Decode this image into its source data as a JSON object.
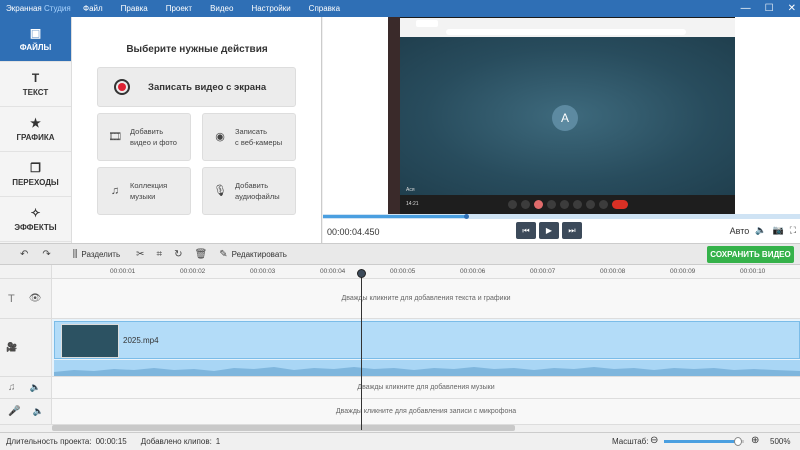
{
  "window": {
    "app_name": "Экранная",
    "app_name_accent": "Студия",
    "minimize": "—",
    "maximize": "☐",
    "close": "✕"
  },
  "menu": [
    "Файл",
    "Правка",
    "Проект",
    "Видео",
    "Настройки",
    "Справка"
  ],
  "sidebar": [
    {
      "label": "ФАЙЛЫ",
      "icon": "files-icon",
      "glyph": "▣",
      "active": true
    },
    {
      "label": "ТЕКСТ",
      "icon": "text-icon",
      "glyph": "T",
      "active": false
    },
    {
      "label": "ГРАФИКА",
      "icon": "star-icon",
      "glyph": "★",
      "active": false
    },
    {
      "label": "ПЕРЕХОДЫ",
      "icon": "transitions-icon",
      "glyph": "❐",
      "active": false
    },
    {
      "label": "ЭФФЕКТЫ",
      "icon": "magic-wand-icon",
      "glyph": "✧",
      "active": false
    }
  ],
  "actions": {
    "heading": "Выберите нужные действия",
    "record_screen": "Записать видео с экрана",
    "add_video": [
      "Добавить",
      "видео и фото"
    ],
    "record_webcam": [
      "Записать",
      "с веб-камеры"
    ],
    "music_collection": [
      "Коллекция",
      "музыки"
    ],
    "add_audio": [
      "Добавить",
      "аудиофайлы"
    ]
  },
  "preview": {
    "avatar_letter": "A",
    "timecode": "00:00:04.450",
    "progress": 0.3,
    "auto_label": "Авто",
    "transport": {
      "prev": "⏮",
      "play": "▶",
      "next": "⏭"
    },
    "meet_time": "14:21",
    "meet_name": "Ася"
  },
  "toolbar": {
    "undo": "↶",
    "redo": "↷",
    "split_label": "Разделить",
    "edit_label": "Редактировать",
    "save_label": "СОХРАНИТЬ ВИДЕО"
  },
  "ruler": {
    "ticks": [
      "00:00:01",
      "00:00:02",
      "00:00:03",
      "00:00:04",
      "00:00:05",
      "00:00:06",
      "00:00:07",
      "00:00:08",
      "00:00:09",
      "00:00:10"
    ]
  },
  "tracks": {
    "text_hint": "Дважды кликните для добавления текста и графики",
    "clip_name": "2025.mp4",
    "music_hint": "Дважды кликните для добавления музыки",
    "mic_hint": "Дважды кликните для добавления записи с микрофона"
  },
  "status": {
    "duration_label": "Длительность проекта:",
    "duration_value": "00:00:15",
    "clips_label": "Добавлено клипов:",
    "clips_value": "1",
    "scale_label": "Масштаб:",
    "zoom_value": "500%",
    "zoom_level": 0.92
  }
}
